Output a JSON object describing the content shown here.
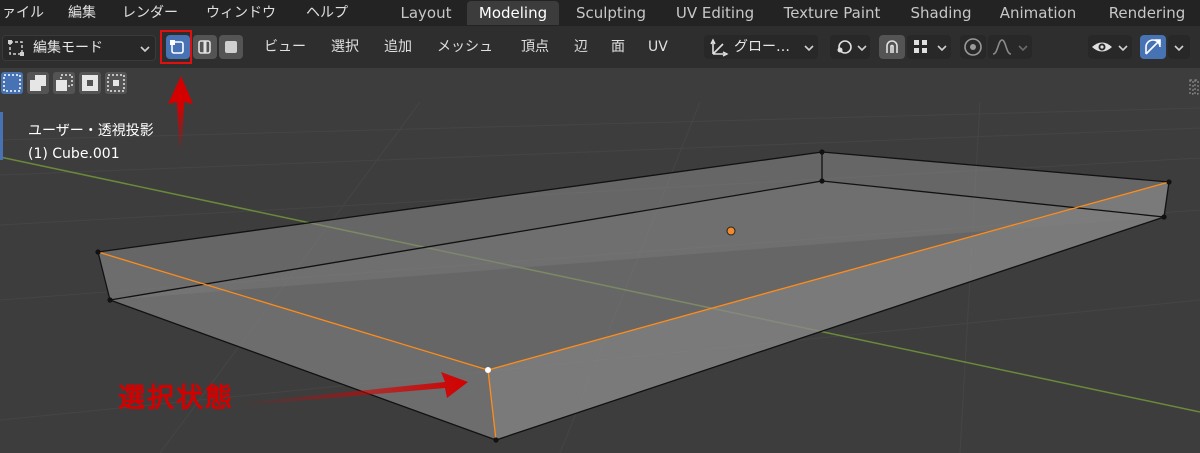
{
  "menu": {
    "items": [
      "ァイル",
      "編集",
      "レンダー",
      "ウィンドウ",
      "ヘルプ"
    ]
  },
  "workspaces": {
    "tabs": [
      "Layout",
      "Modeling",
      "Sculpting",
      "UV Editing",
      "Texture Paint",
      "Shading",
      "Animation",
      "Rendering"
    ],
    "active": "Modeling"
  },
  "header": {
    "mode_label": "編集モード",
    "menus": [
      "ビュー",
      "選択",
      "追加",
      "メッシュ",
      "頂点",
      "辺",
      "面",
      "UV"
    ],
    "transform_orientation": "グロー…",
    "select_mode_active": "vertex"
  },
  "viewport": {
    "view_label": "ユーザー・透視投影",
    "object_label": "(1) Cube.001",
    "annotation": "選択状態"
  },
  "colors": {
    "accent_blue": "#4772b3",
    "annotation_red": "#d40000",
    "selection_orange": "#ff8c1a",
    "origin_orange": "#f08a2c"
  },
  "icons": {
    "edit_mode": "mesh-edit-icon",
    "vertex_select": "vertex-select-icon",
    "edge_select": "edge-select-icon",
    "face_select": "face-select-icon",
    "transform": "transform-orientation-icon",
    "pivot": "pivot-icon",
    "snap": "snap-icon",
    "proportional": "proportional-edit-icon",
    "falloff": "falloff-icon",
    "visibility": "visibility-icon",
    "gizmo": "gizmo-icon",
    "overlay": "overlay-icon"
  }
}
